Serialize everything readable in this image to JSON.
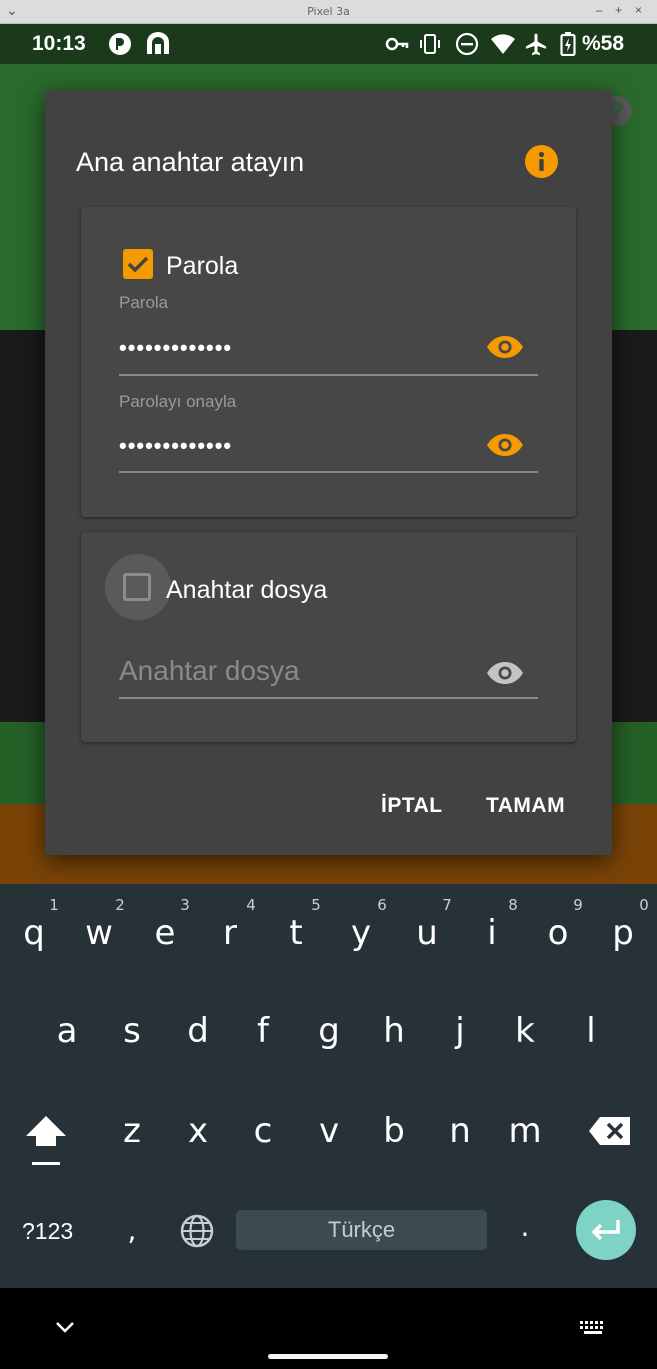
{
  "frame": {
    "title": "Pixel 3a",
    "minimize": "–",
    "maximize": "+",
    "close": "×"
  },
  "status_bar": {
    "time": "10:13",
    "battery_percent": "%58",
    "icons": [
      "notification-app-icon",
      "notification-app-icon-2",
      "vpn-key-icon",
      "vibrate-icon",
      "do-not-disturb-icon",
      "wifi-icon",
      "airplane-mode-icon",
      "battery-charging-icon"
    ]
  },
  "dialog": {
    "title": "Ana anahtar atayın",
    "password_section": {
      "checkbox_label": "Parola",
      "checked": true,
      "password_label": "Parola",
      "password_value": "•••••••••••••",
      "confirm_label": "Parolayı onayla",
      "confirm_value": "•••••••••••••"
    },
    "keyfile_section": {
      "checkbox_label": "Anahtar dosya",
      "checked": false,
      "placeholder": "Anahtar dosya"
    },
    "cancel_label": "İPTAL",
    "ok_label": "TAMAM"
  },
  "keyboard": {
    "row1": [
      "q",
      "w",
      "e",
      "r",
      "t",
      "y",
      "u",
      "i",
      "o",
      "p"
    ],
    "row1_hints": [
      "1",
      "2",
      "3",
      "4",
      "5",
      "6",
      "7",
      "8",
      "9",
      "0"
    ],
    "row2": [
      "a",
      "s",
      "d",
      "f",
      "g",
      "h",
      "j",
      "k",
      "l"
    ],
    "row3": [
      "z",
      "x",
      "c",
      "v",
      "b",
      "n",
      "m"
    ],
    "symbols_label": "?123",
    "comma": ",",
    "period": ".",
    "space_label": "Türkçe"
  },
  "colors": {
    "accent": "#f59a00",
    "dialog_bg": "#424242",
    "keyboard_bg": "#263238",
    "enter_key": "#7ed3c4",
    "app_green": "#2a6a2c"
  }
}
